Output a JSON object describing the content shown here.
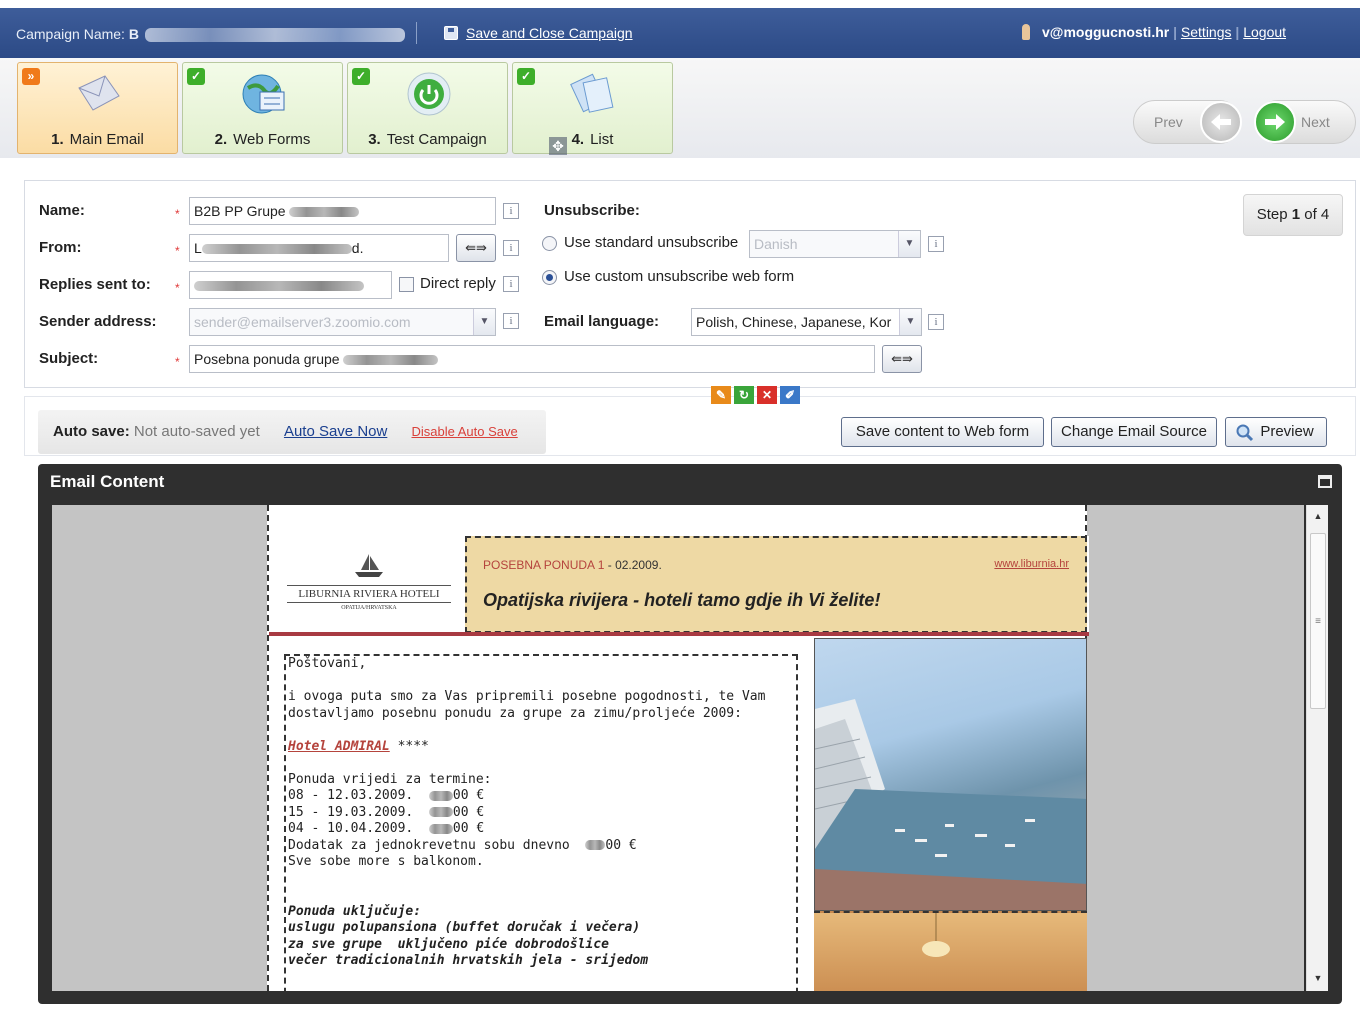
{
  "topbar": {
    "campaign_label": "Campaign Name:",
    "campaign_name_visible": "B",
    "save_close": "Save and Close Campaign",
    "user_email_visible": "v@moggucnosti.hr",
    "settings": "Settings",
    "logout": "Logout"
  },
  "steps": [
    {
      "num": "1.",
      "label": "Main Email",
      "active": true
    },
    {
      "num": "2.",
      "label": "Web Forms",
      "active": false
    },
    {
      "num": "3.",
      "label": "Test Campaign",
      "active": false
    },
    {
      "num": "4.",
      "label": "List",
      "active": false
    }
  ],
  "nav": {
    "prev": "Prev",
    "next": "Next"
  },
  "form": {
    "name_label": "Name:",
    "name_value": "B2B PP Grupe",
    "from_label": "From:",
    "from_value": "L",
    "from_value_end": "d.",
    "replies_label": "Replies sent to:",
    "direct_reply": "Direct reply",
    "sender_label": "Sender address:",
    "sender_value": "sender@emailserver3.zoomio.com",
    "subject_label": "Subject:",
    "subject_value": "Posebna ponuda grupe",
    "unsubscribe_label": "Unsubscribe:",
    "unsub_standard": "Use standard unsubscribe",
    "unsub_lang": "Danish",
    "unsub_custom": "Use custom unsubscribe web form",
    "email_language_label": "Email language:",
    "email_language_value": "Polish, Chinese, Japanese, Kor",
    "arrow_symbol": "⇚⇛",
    "info_symbol": "i"
  },
  "step_indicator": {
    "prefix": "Step",
    "current": "1",
    "suffix": "of 4"
  },
  "autosave": {
    "label": "Auto save:",
    "status": "Not auto-saved yet",
    "save_now": "Auto Save Now",
    "disable": "Disable Auto Save"
  },
  "buttons": {
    "save_web_form": "Save content to Web form",
    "change_source": "Change Email Source",
    "preview": "Preview"
  },
  "email_content": {
    "title": "Email Content",
    "logo_line1": "LIBURNIA RIVIERA HOTELI",
    "logo_line2": "OPATIJA/HRVATSKA",
    "promo_offer": "POSEBNA PONUDA 1",
    "promo_date": "- 02.2009.",
    "promo_url": "www.liburnia.hr",
    "promo_headline": "Opatijska rivijera - hoteli tamo gdje ih Vi želite!",
    "greeting": "Poštovani,",
    "intro1": "i ovoga puta smo za Vas pripremili posebne pogodnosti, te Vam",
    "intro2": "dostavljamo posebnu ponudu za grupe za zimu/proljeće 2009:",
    "hotel": "Hotel ADMIRAL",
    "stars": " ****",
    "valid": "Ponuda vrijedi za termine:",
    "term1": "08 - 12.03.2009.",
    "term2": "15 - 19.03.2009.",
    "term3": "04 - 10.04.2009.",
    "price_suffix": "00 €",
    "single": "Dodatak za jednokrevetnu sobu dnevno",
    "single_price": "00 €",
    "rooms": "Sve sobe more s balkonom.",
    "includes": "Ponuda uključuje:",
    "inc1": "uslugu polupansiona (buffet doručak i večera)",
    "inc2": "za sve grupe  uključeno piće dobrodošlice",
    "inc3": "večer tradicionalnih hrvatskih jela - srijedom"
  },
  "colors": {
    "topbar": "#2c4a86",
    "step_active": "#fbdca4",
    "step_done": "#e2f0cf",
    "accent_red": "#b5443d"
  }
}
